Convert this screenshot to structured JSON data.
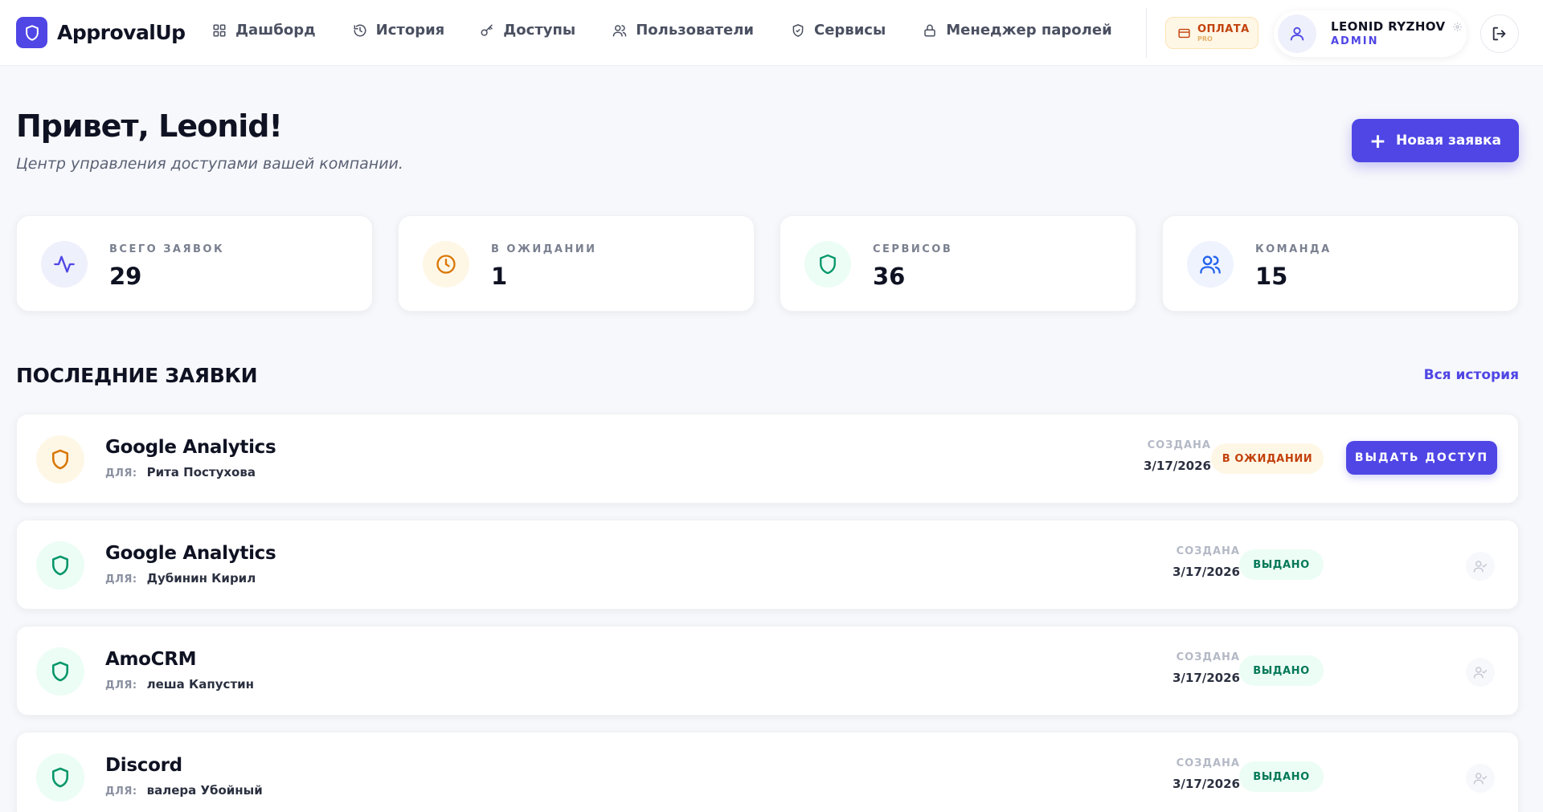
{
  "app": {
    "name": "ApprovalUp"
  },
  "nav": [
    {
      "label": "Дашборд",
      "icon": "dashboard-icon"
    },
    {
      "label": "История",
      "icon": "history-icon"
    },
    {
      "label": "Доступы",
      "icon": "key-icon"
    },
    {
      "label": "Пользователи",
      "icon": "users-icon"
    },
    {
      "label": "Сервисы",
      "icon": "shield-icon"
    },
    {
      "label": "Менеджер паролей",
      "icon": "lock-icon"
    }
  ],
  "payment": {
    "label": "ОПЛАТА",
    "plan": "PRO"
  },
  "user": {
    "name": "LEONID RYZHOV",
    "role": "ADMIN"
  },
  "greeting": {
    "title": "Привет, Leonid!",
    "subtitle": "Центр управления доступами вашей компании."
  },
  "new_request_label": "Новая заявка",
  "stats": [
    {
      "label": "ВСЕГО ЗАЯВОК",
      "value": "29",
      "icon": "activity-icon",
      "color": "#4f46e5"
    },
    {
      "label": "В ОЖИДАНИИ",
      "value": "1",
      "icon": "clock-icon",
      "color": "#d97706"
    },
    {
      "label": "СЕРВИСОВ",
      "value": "36",
      "icon": "shield-icon",
      "color": "#059669"
    },
    {
      "label": "КОМАНДА",
      "value": "15",
      "icon": "users-icon",
      "color": "#2563eb"
    }
  ],
  "recent": {
    "title": "ПОСЛЕДНИЕ ЗАЯВКИ",
    "all_history_label": "Вся история",
    "items": [
      {
        "service": "Google Analytics",
        "for_label": "ДЛЯ:",
        "for_user": "Рита Постухова",
        "created_label": "СОЗДАНА",
        "date": "3/17/2026",
        "status": "В ОЖИДАНИИ",
        "action": "ВЫДАТЬ ДОСТУП"
      },
      {
        "service": "Google Analytics",
        "for_label": "ДЛЯ:",
        "for_user": "Дубинин Кирил",
        "created_label": "СОЗДАНА",
        "date": "3/17/2026",
        "status": "ВЫДАНО"
      },
      {
        "service": "AmoCRM",
        "for_label": "ДЛЯ:",
        "for_user": "леша Капустин",
        "created_label": "СОЗДАНА",
        "date": "3/17/2026",
        "status": "ВЫДАНО"
      },
      {
        "service": "Discord",
        "for_label": "ДЛЯ:",
        "for_user": "валера Убойный",
        "created_label": "СОЗДАНА",
        "date": "3/17/2026",
        "status": "ВЫДАНО"
      }
    ]
  },
  "colors": {
    "accent": "#4f46e5",
    "pending": "#d97706",
    "granted": "#059669"
  }
}
